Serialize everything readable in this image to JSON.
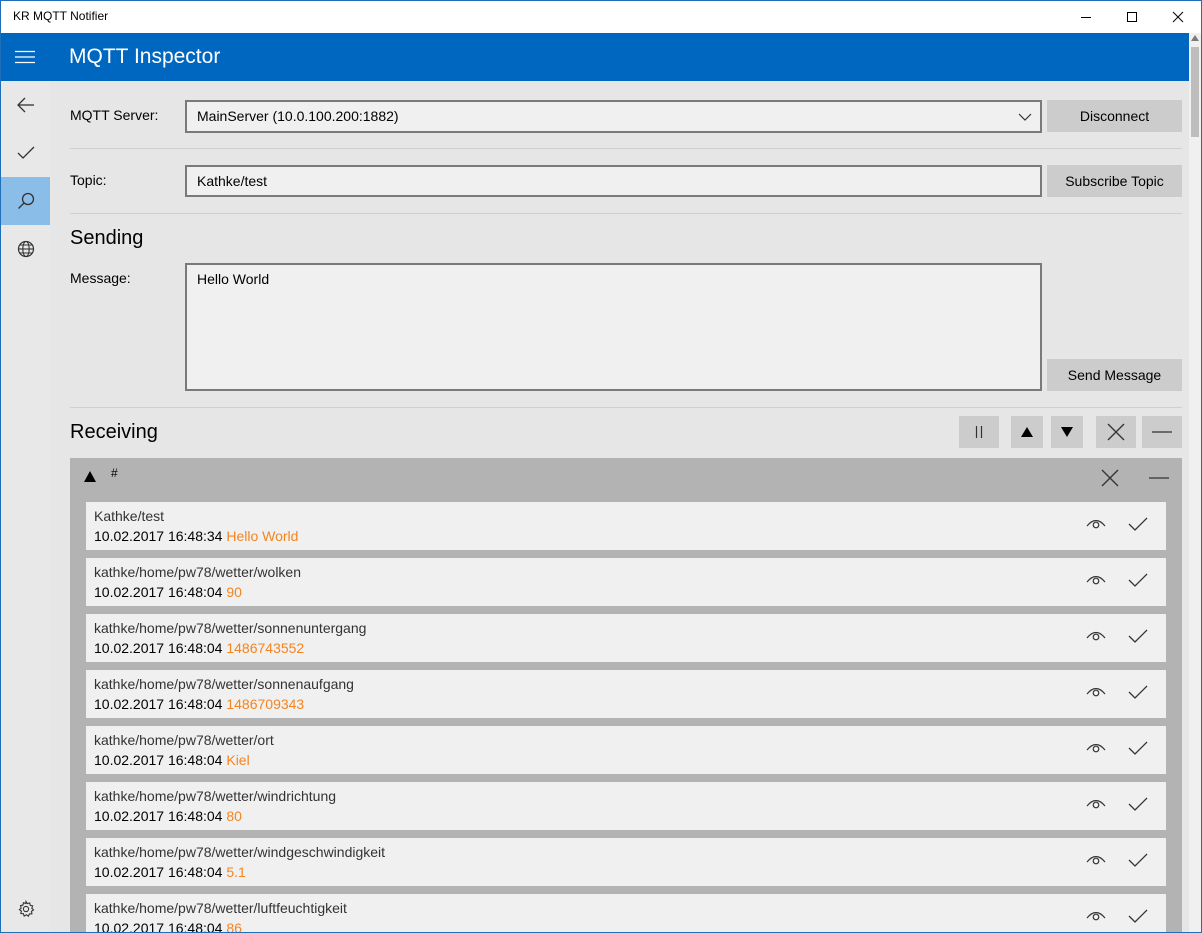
{
  "window": {
    "title": "KR MQTT Notifier"
  },
  "appbar": {
    "title": "MQTT Inspector"
  },
  "server": {
    "label": "MQTT Server:",
    "selected": "MainServer (10.0.100.200:1882)",
    "disconnect_label": "Disconnect"
  },
  "topic": {
    "label": "Topic:",
    "value": "Kathke/test",
    "subscribe_label": "Subscribe Topic"
  },
  "sending": {
    "heading": "Sending",
    "message_label": "Message:",
    "message_value": "Hello World",
    "send_label": "Send Message"
  },
  "receiving": {
    "heading": "Receiving",
    "group_label": "#",
    "messages": [
      {
        "topic": "Kathke/test",
        "timestamp": "10.02.2017 16:48:34",
        "payload": "Hello World"
      },
      {
        "topic": "kathke/home/pw78/wetter/wolken",
        "timestamp": "10.02.2017 16:48:04",
        "payload": "90"
      },
      {
        "topic": "kathke/home/pw78/wetter/sonnenuntergang",
        "timestamp": "10.02.2017 16:48:04",
        "payload": "1486743552"
      },
      {
        "topic": "kathke/home/pw78/wetter/sonnenaufgang",
        "timestamp": "10.02.2017 16:48:04",
        "payload": "1486709343"
      },
      {
        "topic": "kathke/home/pw78/wetter/ort",
        "timestamp": "10.02.2017 16:48:04",
        "payload": "Kiel"
      },
      {
        "topic": "kathke/home/pw78/wetter/windrichtung",
        "timestamp": "10.02.2017 16:48:04",
        "payload": "80"
      },
      {
        "topic": "kathke/home/pw78/wetter/windgeschwindigkeit",
        "timestamp": "10.02.2017 16:48:04",
        "payload": "5.1"
      },
      {
        "topic": "kathke/home/pw78/wetter/luftfeuchtigkeit",
        "timestamp": "10.02.2017 16:48:04",
        "payload": "86"
      }
    ]
  },
  "colors": {
    "accent": "#0067c0",
    "nav_selected": "#8bbde9",
    "payload": "#f5841f"
  },
  "icons": {
    "nav": [
      "hamburger-icon",
      "back-arrow-icon",
      "checkmark-icon",
      "search-icon",
      "globe-icon",
      "settings-gear-icon"
    ],
    "receiving_toolbar": [
      "pause-icon",
      "arrow-up-icon",
      "arrow-down-icon",
      "close-icon",
      "minimize-icon"
    ],
    "message_actions": [
      "eye-icon",
      "checkmark-icon"
    ]
  }
}
